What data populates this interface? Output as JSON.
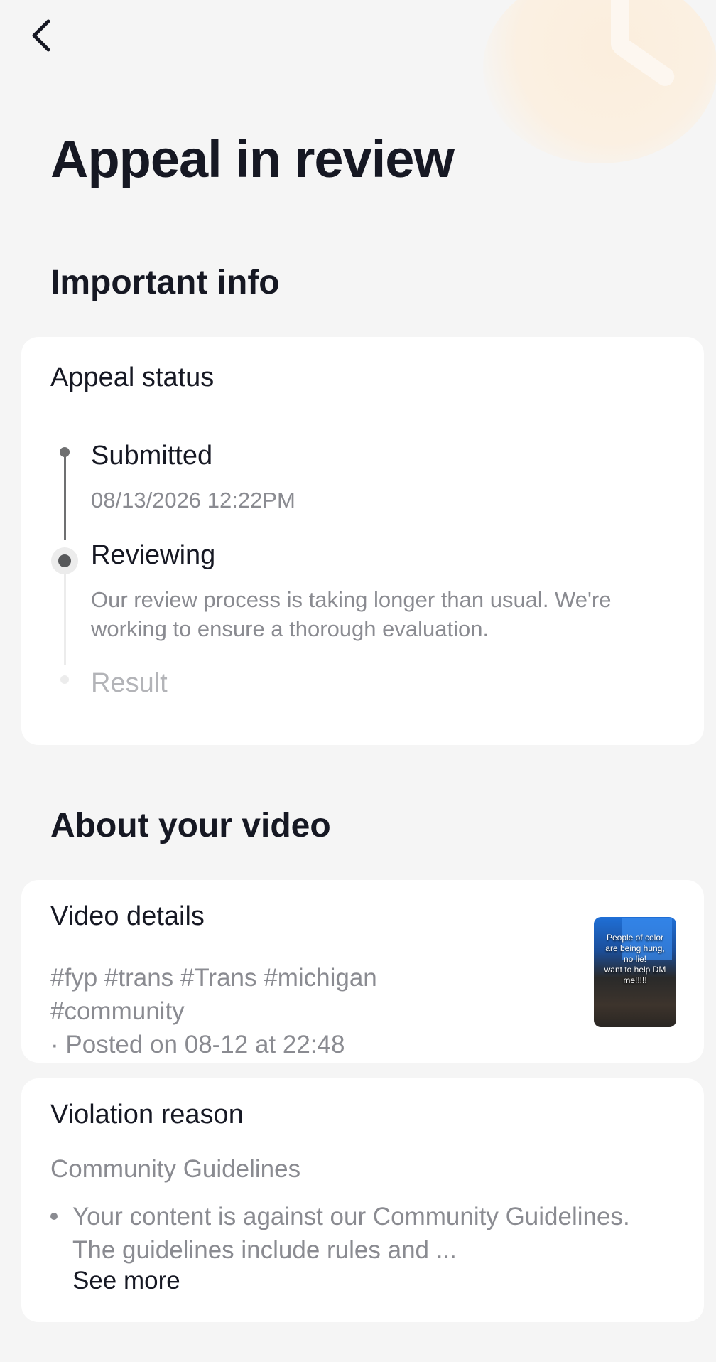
{
  "header": {
    "back_icon": "chevron-left-icon",
    "title": "Appeal in review"
  },
  "important_info": {
    "section_title": "Important info",
    "status_card": {
      "title": "Appeal status",
      "steps": [
        {
          "label": "Submitted",
          "detail": "08/13/2026 12:22PM",
          "state": "done"
        },
        {
          "label": "Reviewing",
          "detail": "Our review process is taking longer than usual. We're working to ensure a thorough evaluation.",
          "state": "current"
        },
        {
          "label": "Result",
          "detail": "",
          "state": "pending"
        }
      ]
    }
  },
  "about_video": {
    "section_title": "About your video",
    "video_card": {
      "title": "Video details",
      "tags_line1": "#fyp #trans #Trans #michigan",
      "tags_line2": "#community",
      "posted": "· Posted on 08-12 at 22:48",
      "thumbnail_caption": "People of color\nare being hung,\nno lie!\nwant to help DM\nme!!!!!"
    },
    "violation_card": {
      "title": "Violation reason",
      "category": "Community Guidelines",
      "description": "Your content is against our Community Guidelines. The guidelines include rules and ...",
      "see_more": "See more"
    }
  },
  "colors": {
    "background": "#f5f5f5",
    "card": "#ffffff",
    "primary_text": "#161823",
    "secondary_text": "#8a8b91"
  }
}
